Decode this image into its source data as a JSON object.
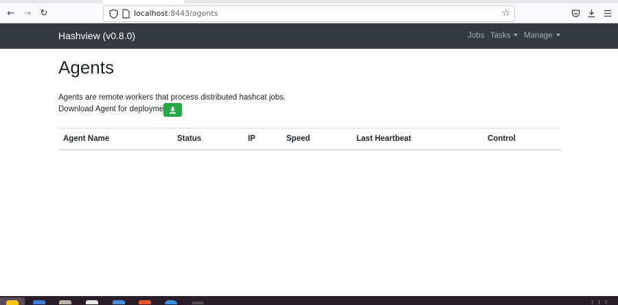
{
  "browser": {
    "url_host": "localhost",
    "url_path": ":8443/agents"
  },
  "navbar": {
    "brand": "Hashview (v0.8.0)",
    "items": [
      {
        "label": "Jobs",
        "dropdown": false
      },
      {
        "label": "Tasks",
        "dropdown": true
      },
      {
        "label": "Manage",
        "dropdown": true
      }
    ]
  },
  "main": {
    "title": "Agents",
    "description": "Agents are remote workers that process distributed hashcat jobs.",
    "download_label": "Download Agent for deployment",
    "download_icon": "download-icon"
  },
  "table": {
    "columns": [
      "Agent Name",
      "Status",
      "IP",
      "Speed",
      "Last Heartbeat",
      "Control"
    ],
    "rows": []
  },
  "colors": {
    "navbar_bg": "#343a40",
    "success": "#28a745",
    "taskbar_bg": "#2b1d2a"
  }
}
